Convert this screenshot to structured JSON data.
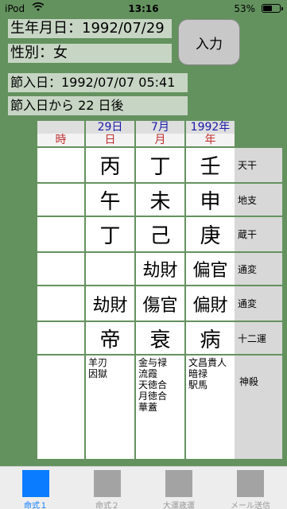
{
  "status_bar": {
    "carrier": "iPod",
    "time": "13:16",
    "battery_percent": "53%",
    "battery_level": 0.53
  },
  "info": {
    "birth": "生年月日：1992/07/29",
    "gender": "性別：女",
    "setsu_date": "節入日：1992/07/07 05:41",
    "setsu_days": "節入日から 22 日後"
  },
  "enter_button": "入力",
  "header": {
    "top": [
      "",
      "29日",
      "7月",
      "1992年"
    ],
    "bottom": [
      "時",
      "日",
      "月",
      "年"
    ]
  },
  "rows": [
    {
      "label": "天干",
      "cells": [
        "",
        "丙",
        "丁",
        "壬"
      ]
    },
    {
      "label": "地支",
      "cells": [
        "",
        "午",
        "未",
        "申"
      ]
    },
    {
      "label": "蔵干",
      "cells": [
        "",
        "丁",
        "己",
        "庚"
      ]
    },
    {
      "label": "通変",
      "cells": [
        "",
        "",
        "劫財",
        "偏官"
      ]
    },
    {
      "label": "通変",
      "cells": [
        "",
        "劫財",
        "傷官",
        "偏財"
      ]
    },
    {
      "label": "十二運",
      "cells": [
        "",
        "帝",
        "衰",
        "病"
      ]
    }
  ],
  "shinsatsu": {
    "label": "神殺",
    "cells": [
      [],
      [
        "羊刃",
        "因獄"
      ],
      [
        "金与禄",
        "流霞",
        "天徳合",
        "月徳合",
        "華蓋"
      ],
      [
        "文昌貴人",
        "暗禄",
        "駅馬"
      ]
    ]
  },
  "tabs": [
    {
      "label": "命式１",
      "active": true
    },
    {
      "label": "命式２",
      "active": false
    },
    {
      "label": "大運歳運",
      "active": false
    },
    {
      "label": "メール送信",
      "active": false
    }
  ],
  "colors": {
    "background": "#64925f",
    "info_box": "#c7d6c4",
    "header_blue": "#1a1aa8",
    "header_red": "#c03030",
    "tab_active": "#0a7cff"
  }
}
